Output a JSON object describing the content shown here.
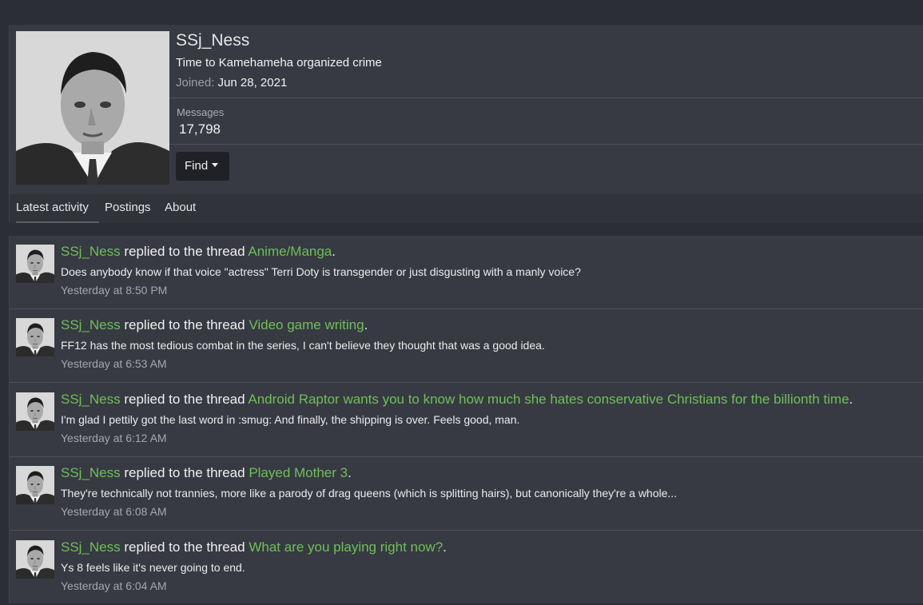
{
  "profile": {
    "name": "SSj_Ness",
    "title": "Time to Kamehameha organized crime",
    "joined_label": "Joined:",
    "joined_value": "Jun 28, 2021",
    "messages_label": "Messages",
    "messages_value": "17,798",
    "find_label": "Find"
  },
  "tabs": [
    {
      "label": "Latest activity"
    },
    {
      "label": "Postings"
    },
    {
      "label": "About"
    }
  ],
  "activity": [
    {
      "user": "SSj_Ness",
      "action": " replied to the thread ",
      "thread": "Anime/Manga",
      "end": ".",
      "snippet": "Does anybody know if that voice \"actress\" Terri Doty is transgender or just disgusting with a manly voice?",
      "time": "Yesterday at 8:50 PM"
    },
    {
      "user": "SSj_Ness",
      "action": " replied to the thread ",
      "thread": "Video game writing",
      "end": ".",
      "snippet": "FF12 has the most tedious combat in the series, I can't believe they thought that was a good idea.",
      "time": "Yesterday at 6:53 AM"
    },
    {
      "user": "SSj_Ness",
      "action": " replied to the thread ",
      "thread": "Android Raptor wants you to know how much she hates conservative Christians for the billionth time",
      "end": ".",
      "snippet": "I'm glad I pettily got the last word in :smug: And finally, the shipping is over. Feels good, man.",
      "time": "Yesterday at 6:12 AM"
    },
    {
      "user": "SSj_Ness",
      "action": " replied to the thread ",
      "thread": "Played Mother 3",
      "end": ".",
      "snippet": "They're technically not trannies, more like a parody of drag queens (which is splitting hairs), but canonically they're a whole...",
      "time": "Yesterday at 6:08 AM"
    },
    {
      "user": "SSj_Ness",
      "action": " replied to the thread ",
      "thread": "What are you playing right now?",
      "end": ".",
      "snippet": "Ys 8 feels like it's never going to end.",
      "time": "Yesterday at 6:04 AM"
    }
  ]
}
